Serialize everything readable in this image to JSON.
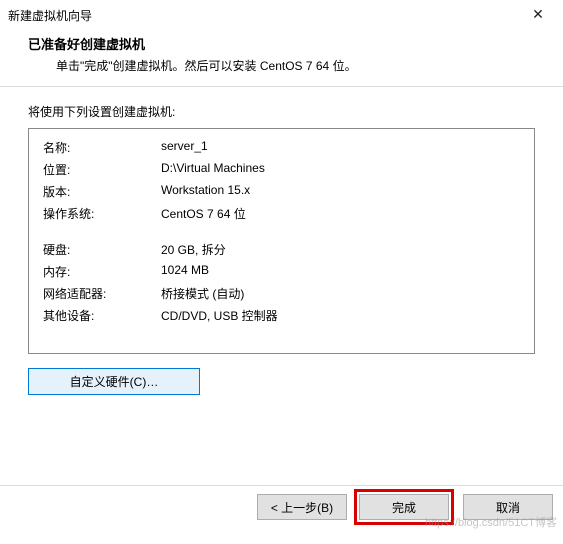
{
  "titlebar": {
    "title": "新建虚拟机向导",
    "close": "✕"
  },
  "header": {
    "heading": "已准备好创建虚拟机",
    "sub": "单击\"完成\"创建虚拟机。然后可以安装 CentOS 7 64 位。"
  },
  "section_label": "将使用下列设置创建虚拟机:",
  "details": {
    "name_label": "名称:",
    "name_value": "server_1",
    "location_label": "位置:",
    "location_value": "D:\\Virtual Machines",
    "version_label": "版本:",
    "version_value": "Workstation 15.x",
    "os_label": "操作系统:",
    "os_value": "CentOS 7 64 位",
    "disk_label": "硬盘:",
    "disk_value": "20 GB, 拆分",
    "memory_label": "内存:",
    "memory_value": "1024 MB",
    "nic_label": "网络适配器:",
    "nic_value": "桥接模式 (自动)",
    "other_label": "其他设备:",
    "other_value": "CD/DVD, USB 控制器"
  },
  "buttons": {
    "customize": "自定义硬件(C)…",
    "back": "< 上一步(B)",
    "finish": "完成",
    "cancel": "取消"
  },
  "watermark": "https://blog.csdn/51CT博客"
}
